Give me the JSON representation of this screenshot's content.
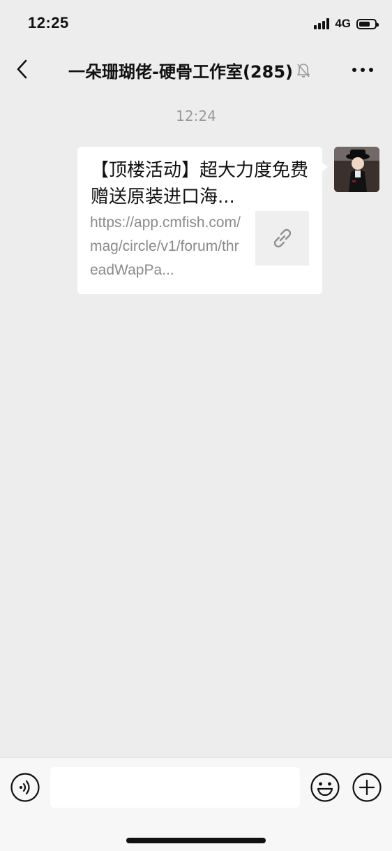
{
  "status_bar": {
    "time": "12:25",
    "network": "4G",
    "battery_level": 0.7,
    "icons": [
      "signal-icon",
      "battery-icon"
    ]
  },
  "nav": {
    "title": "一朵珊瑚佬-硬骨工作室(285)",
    "icons": [
      "back-icon",
      "mute-icon",
      "more-icon"
    ]
  },
  "chat": {
    "timestamp": "12:24",
    "messages": [
      {
        "type": "link-card",
        "title": "【顶楼活动】超大力度免费赠送原装进口海...",
        "description": "https://app.cmfish.com/mag/circle/v1/forum/threadWapPa...",
        "thumb_icon": "link-icon",
        "sender_avatar": "avatar"
      }
    ]
  },
  "input_bar": {
    "placeholder": "",
    "icons": [
      "voice-icon",
      "emoji-icon",
      "plus-icon"
    ]
  },
  "colors": {
    "background": "#ededed",
    "bubble": "#ffffff",
    "secondary_text": "#8a8a8a",
    "timestamp_text": "#9a9a9a",
    "input_bar": "#f7f7f7"
  }
}
